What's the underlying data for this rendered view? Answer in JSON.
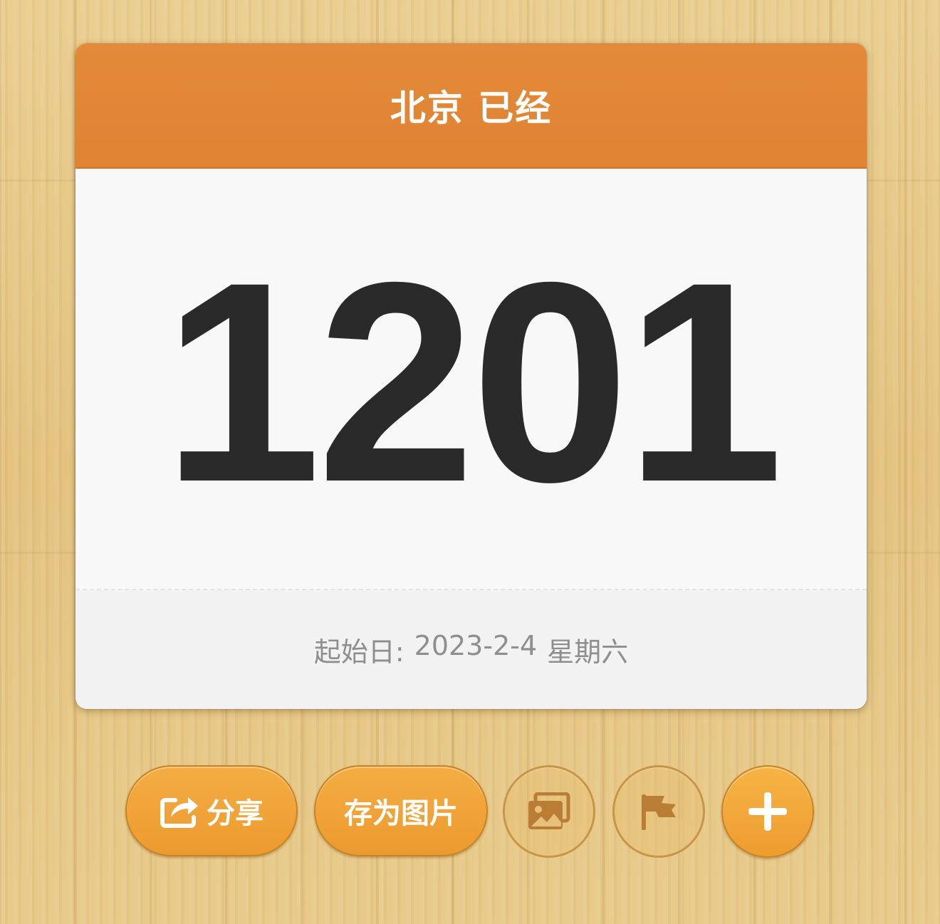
{
  "card": {
    "title": "北京 已经",
    "days": "1201",
    "start_date_label": "起始日:",
    "start_date": "2023-2-4",
    "weekday": "星期六"
  },
  "toolbar": {
    "share_label": "分享",
    "save_image_label": "存为图片",
    "icons": {
      "share": "share-icon",
      "gallery": "photo-icon",
      "flag": "flag-icon",
      "add": "plus-icon"
    }
  },
  "colors": {
    "header": "#e08333",
    "button": "#ee9c2e",
    "number": "#2a2a2a",
    "footer_text": "#8e8e8e"
  }
}
